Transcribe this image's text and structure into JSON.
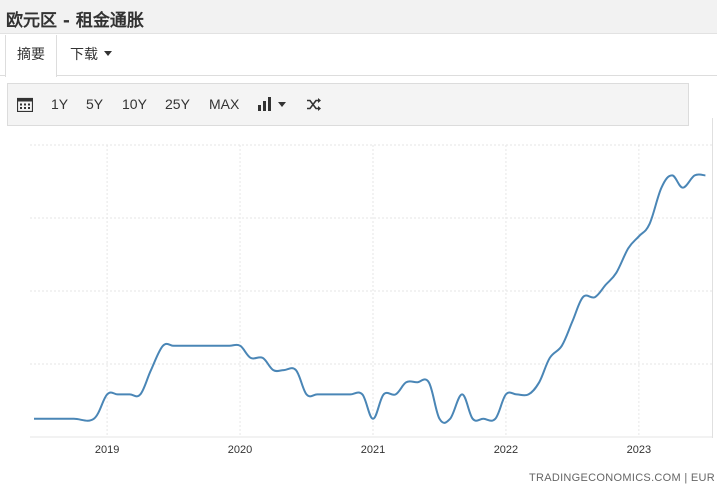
{
  "page": {
    "title": "欧元区 - 租金通胀"
  },
  "tabs": [
    {
      "label": "摘要",
      "active": true
    },
    {
      "label": "下载",
      "has_dropdown": true
    }
  ],
  "toolbar": {
    "calendar_icon": "calendar-icon",
    "ranges": [
      "1Y",
      "5Y",
      "10Y",
      "25Y",
      "MAX"
    ],
    "chart_type_icon": "bar-chart-icon",
    "compare_icon": "shuffle-icon"
  },
  "colors": {
    "line": "#4a86b6",
    "grid": "#e6e6e6",
    "toolbar_bg": "#f4f4f4"
  },
  "chart_data": {
    "type": "line",
    "x_tick_labels": [
      "2019",
      "2020",
      "2021",
      "2022",
      "2023"
    ],
    "grid": true,
    "y_tick_labels_visible": false,
    "series": [
      {
        "points": [
          [
            2018.45,
            1.1
          ],
          [
            2018.6,
            1.1
          ],
          [
            2018.75,
            1.1
          ],
          [
            2018.9,
            1.1
          ],
          [
            2019.0,
            1.3
          ],
          [
            2019.08,
            1.3
          ],
          [
            2019.17,
            1.3
          ],
          [
            2019.25,
            1.3
          ],
          [
            2019.33,
            1.5
          ],
          [
            2019.42,
            1.7
          ],
          [
            2019.5,
            1.7
          ],
          [
            2019.58,
            1.7
          ],
          [
            2019.67,
            1.7
          ],
          [
            2019.75,
            1.7
          ],
          [
            2019.83,
            1.7
          ],
          [
            2019.92,
            1.7
          ],
          [
            2020.0,
            1.7
          ],
          [
            2020.08,
            1.6
          ],
          [
            2020.17,
            1.6
          ],
          [
            2020.25,
            1.5
          ],
          [
            2020.33,
            1.5
          ],
          [
            2020.42,
            1.5
          ],
          [
            2020.5,
            1.3
          ],
          [
            2020.58,
            1.3
          ],
          [
            2020.67,
            1.3
          ],
          [
            2020.75,
            1.3
          ],
          [
            2020.83,
            1.3
          ],
          [
            2020.92,
            1.3
          ],
          [
            2021.0,
            1.1
          ],
          [
            2021.08,
            1.3
          ],
          [
            2021.17,
            1.3
          ],
          [
            2021.25,
            1.4
          ],
          [
            2021.33,
            1.4
          ],
          [
            2021.42,
            1.4
          ],
          [
            2021.5,
            1.1
          ],
          [
            2021.58,
            1.1
          ],
          [
            2021.67,
            1.3
          ],
          [
            2021.75,
            1.1
          ],
          [
            2021.83,
            1.1
          ],
          [
            2021.92,
            1.1
          ],
          [
            2022.0,
            1.3
          ],
          [
            2022.08,
            1.3
          ],
          [
            2022.17,
            1.3
          ],
          [
            2022.25,
            1.4
          ],
          [
            2022.33,
            1.6
          ],
          [
            2022.42,
            1.7
          ],
          [
            2022.5,
            1.9
          ],
          [
            2022.58,
            2.1
          ],
          [
            2022.67,
            2.1
          ],
          [
            2022.75,
            2.2
          ],
          [
            2022.83,
            2.3
          ],
          [
            2022.92,
            2.5
          ],
          [
            2023.0,
            2.6
          ],
          [
            2023.08,
            2.7
          ],
          [
            2023.17,
            3.0
          ],
          [
            2023.25,
            3.1
          ],
          [
            2023.33,
            3.0
          ],
          [
            2023.42,
            3.1
          ],
          [
            2023.5,
            3.1
          ]
        ]
      }
    ]
  },
  "credit": "TRADINGECONOMICS.COM | EUR"
}
